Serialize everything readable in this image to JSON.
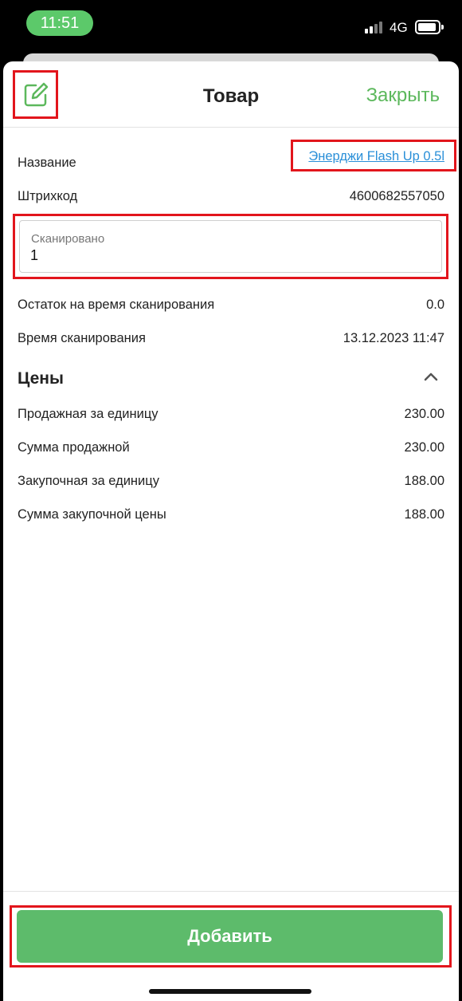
{
  "status": {
    "time": "11:51",
    "network": "4G",
    "signal_icon": "cellular-signal-icon",
    "battery_icon": "battery-icon"
  },
  "header": {
    "edit_icon": "edit-icon",
    "title": "Товар",
    "close_label": "Закрыть"
  },
  "details": {
    "name_label": "Название",
    "name_value": "Энерджи Flash Up 0.5l",
    "barcode_label": "Штрихкод",
    "barcode_value": "4600682557050"
  },
  "scanned": {
    "label": "Сканировано",
    "value": "1"
  },
  "scan_info": {
    "stock_label": "Остаток на время сканирования",
    "stock_value": "0.0",
    "time_label": "Время сканирования",
    "time_value": "13.12.2023 11:47"
  },
  "prices": {
    "title": "Цены",
    "toggle_icon": "chevron-up-icon",
    "items": [
      {
        "label": "Продажная за единицу",
        "value": "230.00"
      },
      {
        "label": "Сумма продажной",
        "value": "230.00"
      },
      {
        "label": "Закупочная за единицу",
        "value": "188.00"
      },
      {
        "label": "Сумма закупочной цены",
        "value": "188.00"
      }
    ]
  },
  "footer": {
    "add_label": "Добавить"
  },
  "colors": {
    "accent": "#5dbb6b",
    "link": "#2a8fd8",
    "highlight": "#e2151c"
  }
}
